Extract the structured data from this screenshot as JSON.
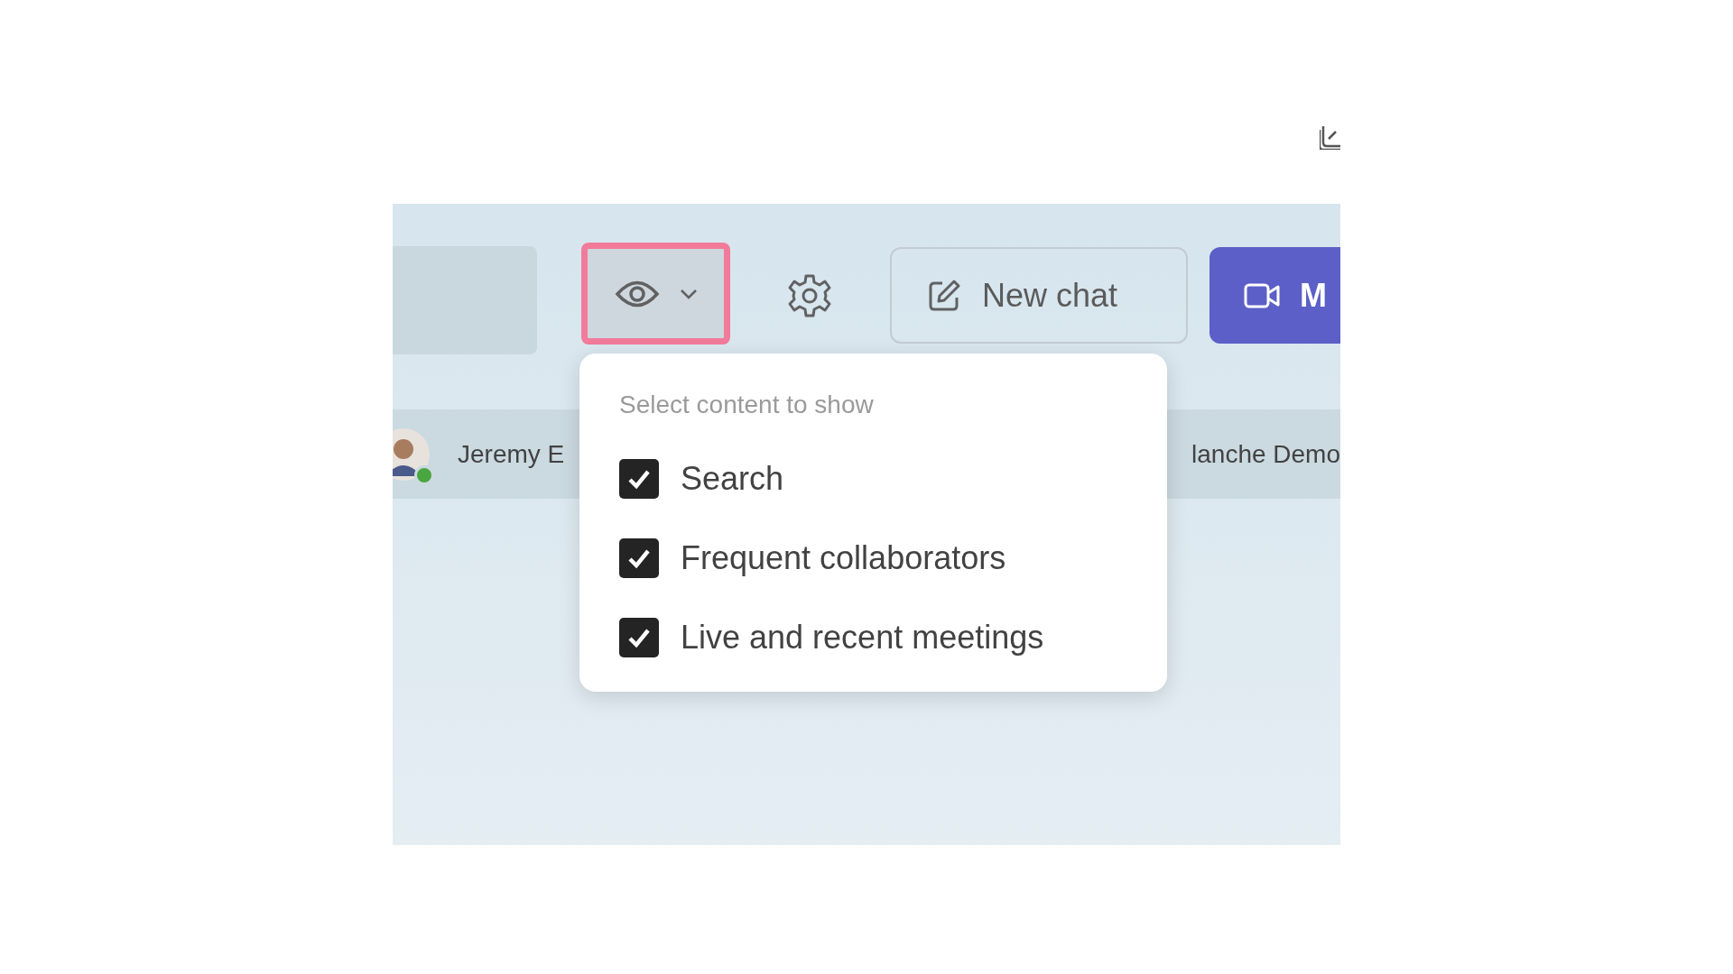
{
  "toolbar": {
    "view_button": {
      "highlighted": true
    },
    "new_chat": "New chat",
    "meet": "M"
  },
  "recent_row": {
    "left_name": "Jeremy E",
    "left_online": true,
    "right_name": "lanche Demo"
  },
  "menu": {
    "title": "Select content to show",
    "items": [
      {
        "label": "Search",
        "checked": true
      },
      {
        "label": "Frequent collaborators",
        "checked": true
      },
      {
        "label": "Live and recent meetings",
        "checked": true
      }
    ]
  }
}
